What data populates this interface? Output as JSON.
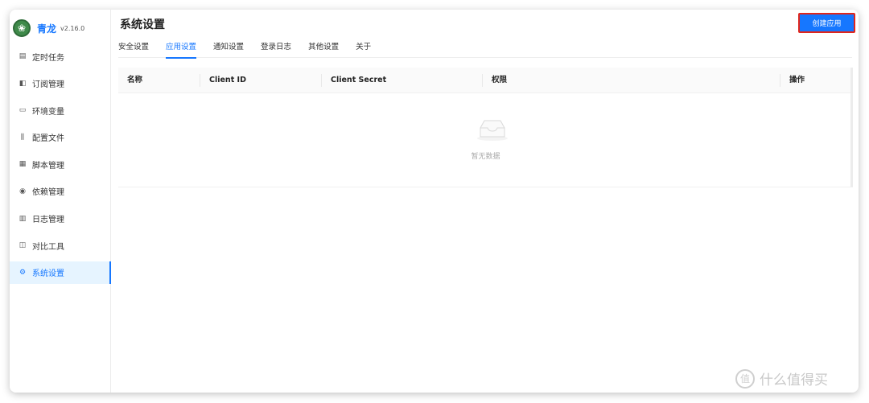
{
  "app": {
    "name": "青龙",
    "version": "v2.16.0",
    "logo_icon": "qinglong-logo-icon"
  },
  "sidebar": {
    "items": [
      {
        "label": "定时任务",
        "icon": "calendar-icon",
        "glyph": "▤"
      },
      {
        "label": "订阅管理",
        "icon": "subscription-icon",
        "glyph": "◧"
      },
      {
        "label": "环境变量",
        "icon": "monitor-icon",
        "glyph": "▭"
      },
      {
        "label": "配置文件",
        "icon": "sliders-icon",
        "glyph": "⫼"
      },
      {
        "label": "脚本管理",
        "icon": "script-icon",
        "glyph": "▦"
      },
      {
        "label": "依赖管理",
        "icon": "dependency-icon",
        "glyph": "◉"
      },
      {
        "label": "日志管理",
        "icon": "log-icon",
        "glyph": "▥"
      },
      {
        "label": "对比工具",
        "icon": "diff-icon",
        "glyph": "◫"
      },
      {
        "label": "系统设置",
        "icon": "settings-icon",
        "glyph": "⚙",
        "active": true
      }
    ]
  },
  "header": {
    "title": "系统设置",
    "create_button": "创建应用"
  },
  "tabs": [
    {
      "label": "安全设置"
    },
    {
      "label": "应用设置",
      "active": true
    },
    {
      "label": "通知设置"
    },
    {
      "label": "登录日志"
    },
    {
      "label": "其他设置"
    },
    {
      "label": "关于"
    }
  ],
  "table": {
    "columns": [
      "名称",
      "Client ID",
      "Client Secret",
      "权限",
      "操作"
    ],
    "empty_text": "暂无数据"
  },
  "watermark": {
    "text": "什么值得买",
    "icon": "zhide-logo-icon"
  },
  "colors": {
    "accent": "#1677ff",
    "highlight_border": "#e0261d"
  }
}
